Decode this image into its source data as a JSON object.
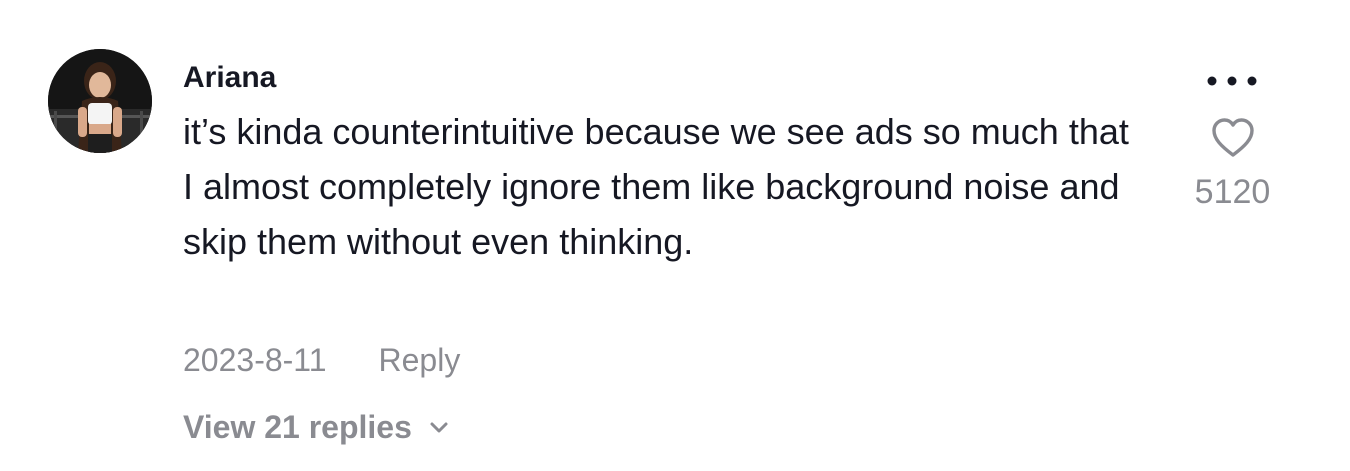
{
  "comment": {
    "username": "Ariana",
    "text": "it’s kinda counterintuitive because we see ads so much that I almost completely ignore them like background noise and skip them without even thinking.",
    "date": "2023-8-11",
    "reply_label": "Reply",
    "view_replies_label": "View 21 replies",
    "like_count": "5120"
  },
  "icons": {
    "avatar": "avatar-photo",
    "more": "more-dots-icon",
    "like": "heart-outline-icon",
    "expand": "chevron-down-icon"
  },
  "colors": {
    "primary_text": "#161823",
    "secondary_text": "#8a8b91"
  }
}
